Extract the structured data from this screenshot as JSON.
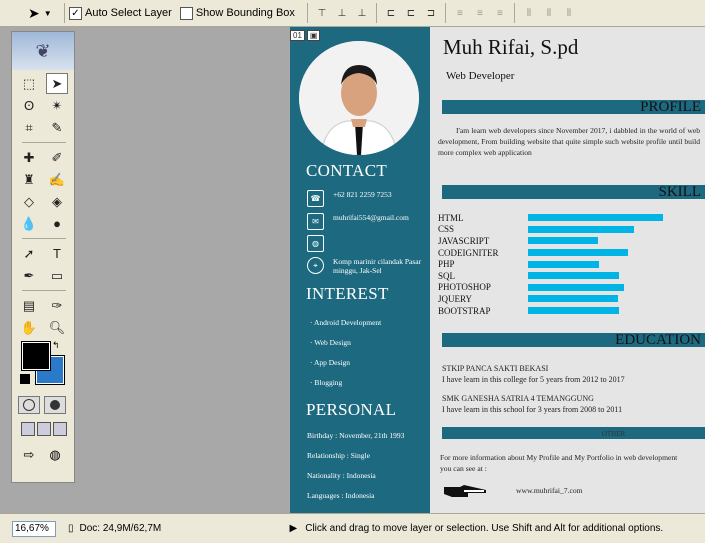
{
  "options_bar": {
    "auto_select_label": "Auto Select Layer",
    "auto_select_checked": true,
    "bounding_box_label": "Show Bounding Box",
    "bounding_box_checked": false
  },
  "status_bar": {
    "zoom": "16,67%",
    "doc_info": "Doc: 24,9M/62,7M",
    "hint": "Click and drag to move layer or selection. Use Shift and Alt for additional options."
  },
  "colors": {
    "foreground": "#000000",
    "background": "#2b79c9",
    "accent": "#1d6a80",
    "skill_bar": "#00b4e6"
  },
  "document": {
    "tab_number": "01",
    "name": "Muh Rifai, S.pd",
    "role": "Web Developer",
    "contact": {
      "title": "CONTACT",
      "items": [
        {
          "icon": "phone-icon",
          "text": "+62 821 2259 7253"
        },
        {
          "icon": "mail-icon",
          "text": "muhrifai554@gmail.com"
        },
        {
          "icon": "globe-icon",
          "text": ""
        },
        {
          "icon": "location-icon",
          "text": "Komp marinir cilandak Pasar minggu, Jak-Sel"
        }
      ]
    },
    "interest": {
      "title": "INTEREST",
      "items": [
        "Android Development",
        "Web Design",
        "App Design",
        "Blogging"
      ]
    },
    "personal": {
      "title": "PERSONAL",
      "items": [
        "Birthday : November, 21th 1993",
        "Relationship : Single",
        "Nationality : Indonesia",
        "Languages : Indonesia"
      ]
    },
    "profile": {
      "title": "PROFILE",
      "text": "I'am learn web developers since November 2017, i dabbled in the world of web development, From building website that quite simple such website profile until build more complex web application"
    },
    "skill": {
      "title": "SKILL",
      "items": [
        {
          "name": "HTML",
          "level": 0.93
        },
        {
          "name": "CSS",
          "level": 0.73
        },
        {
          "name": "JAVASCRIPT",
          "level": 0.48
        },
        {
          "name": "CODEIGNITER",
          "level": 0.69
        },
        {
          "name": "PHP",
          "level": 0.49
        },
        {
          "name": "SQL",
          "level": 0.63
        },
        {
          "name": "PHOTOSHOP",
          "level": 0.66
        },
        {
          "name": "JQUERY",
          "level": 0.62
        },
        {
          "name": "BOOTSTRAP",
          "level": 0.63
        }
      ]
    },
    "education": {
      "title": "EDUCATION",
      "items": [
        {
          "school": "STKIP PANCA SAKTI BEKASI",
          "detail": "I have learn in this college for 5 years from 2012 to 2017"
        },
        {
          "school": "SMK GANESHA SATRIA 4 TEMANGGUNG",
          "detail": "I have learn in this school for 3 years from 2008 to 2011"
        }
      ]
    },
    "other": {
      "title": "OTHER",
      "text": "For more information about My Profile and My Portfolio in web development you can see at :",
      "url": "www.muhrifai_7.com"
    }
  }
}
